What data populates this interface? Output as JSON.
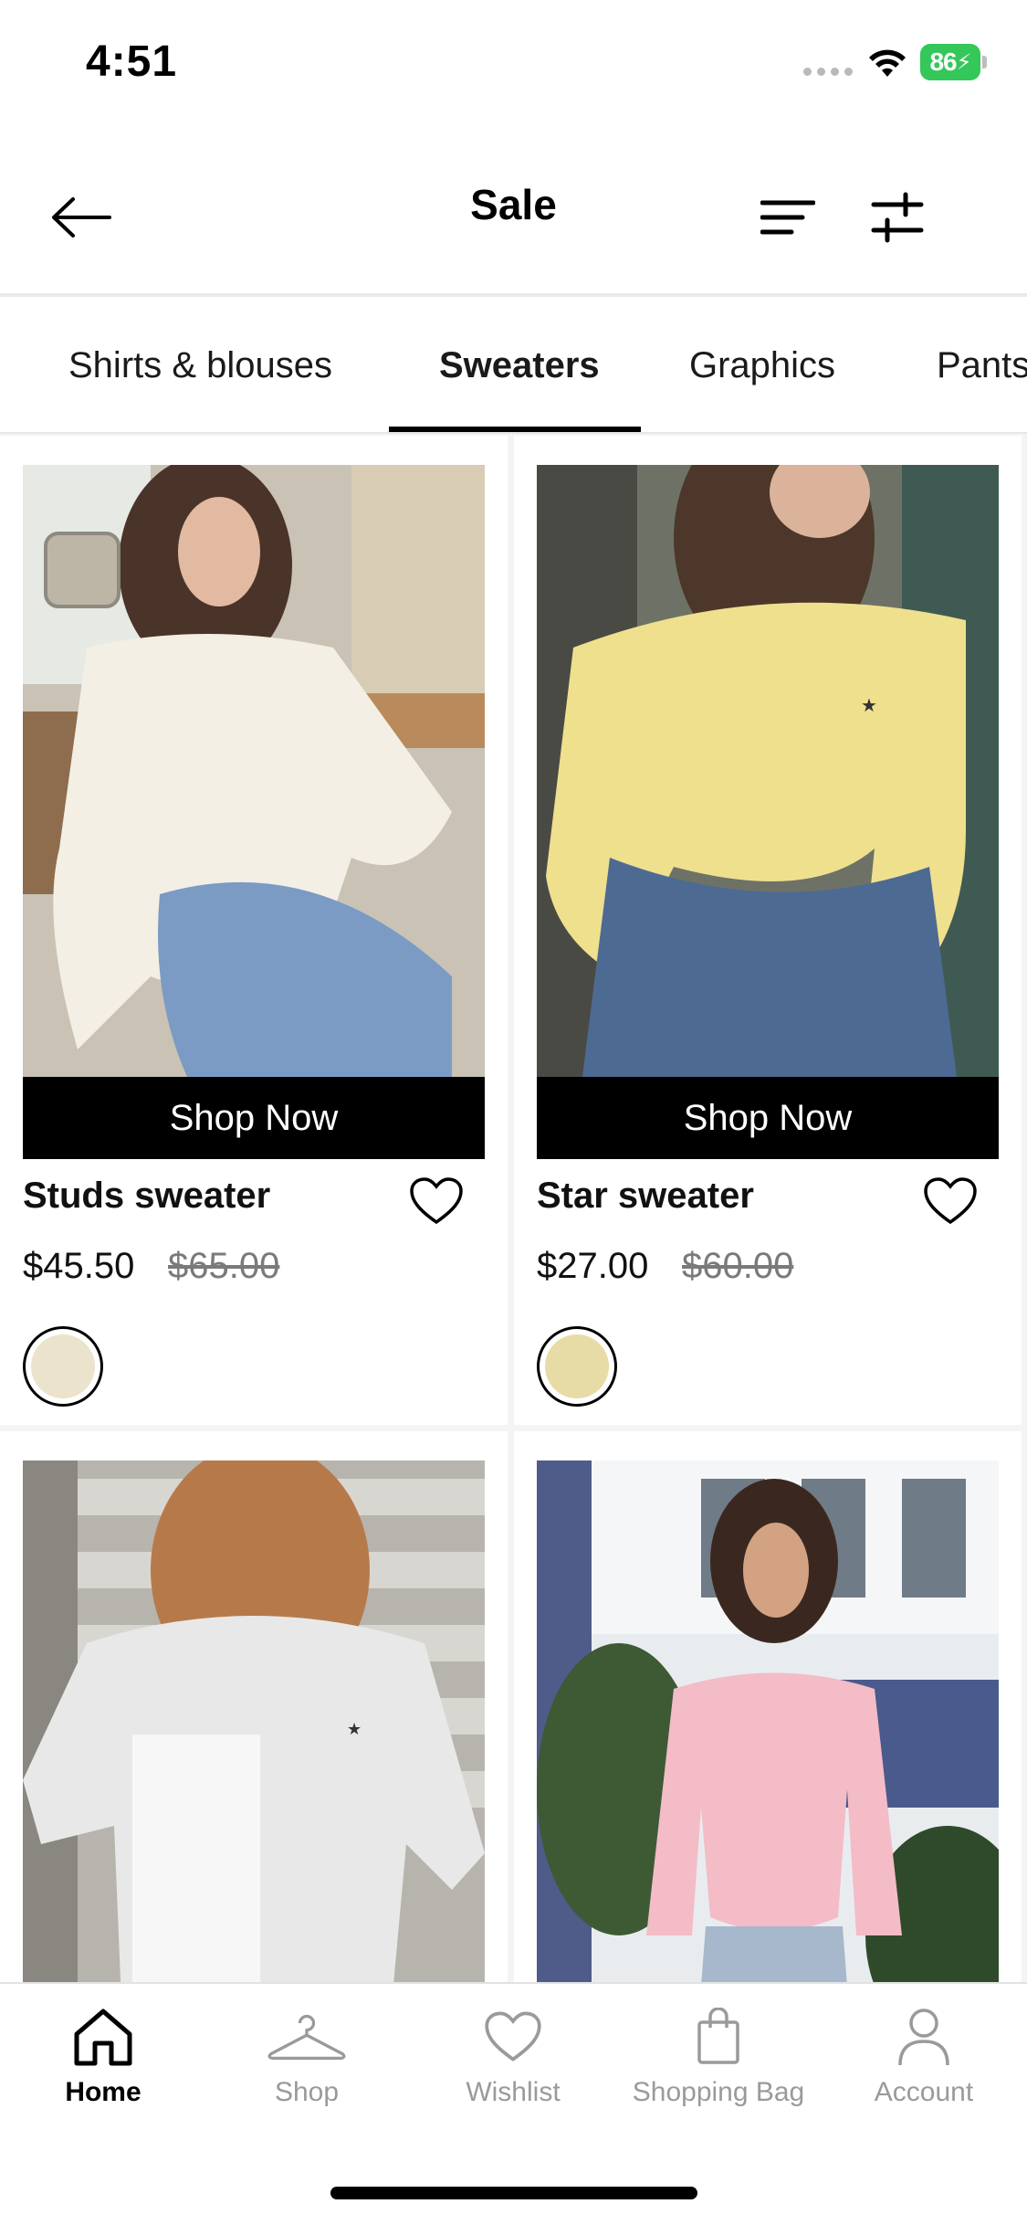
{
  "status_bar": {
    "time": "4:51",
    "battery": "86"
  },
  "header": {
    "title": "Sale"
  },
  "tabs": [
    {
      "label": "Shirts & blouses",
      "active": false
    },
    {
      "label": "Sweaters",
      "active": true
    },
    {
      "label": "Graphics",
      "active": false
    },
    {
      "label": "Pants",
      "active": false
    }
  ],
  "products": [
    {
      "name": "Studs sweater",
      "sale_price": "$45.50",
      "original_price": "$65.00",
      "cta": "Shop Now",
      "swatch_color": "#ece3cc",
      "sweater_color": "#f3efe4"
    },
    {
      "name": "Star sweater",
      "sale_price": "$27.00",
      "original_price": "$60.00",
      "cta": "Shop Now",
      "swatch_color": "#e8dca6",
      "sweater_color": "#efe08e"
    },
    {
      "sweater_color": "#e8e8e8"
    },
    {
      "sweater_color": "#f3bcc7"
    }
  ],
  "bottom_nav": [
    {
      "label": "Home",
      "icon": "home-icon",
      "active": true
    },
    {
      "label": "Shop",
      "icon": "hanger-icon",
      "active": false
    },
    {
      "label": "Wishlist",
      "icon": "heart-icon",
      "active": false
    },
    {
      "label": "Shopping Bag",
      "icon": "shopping-bag-icon",
      "active": false
    },
    {
      "label": "Account",
      "icon": "account-icon",
      "active": false
    }
  ]
}
